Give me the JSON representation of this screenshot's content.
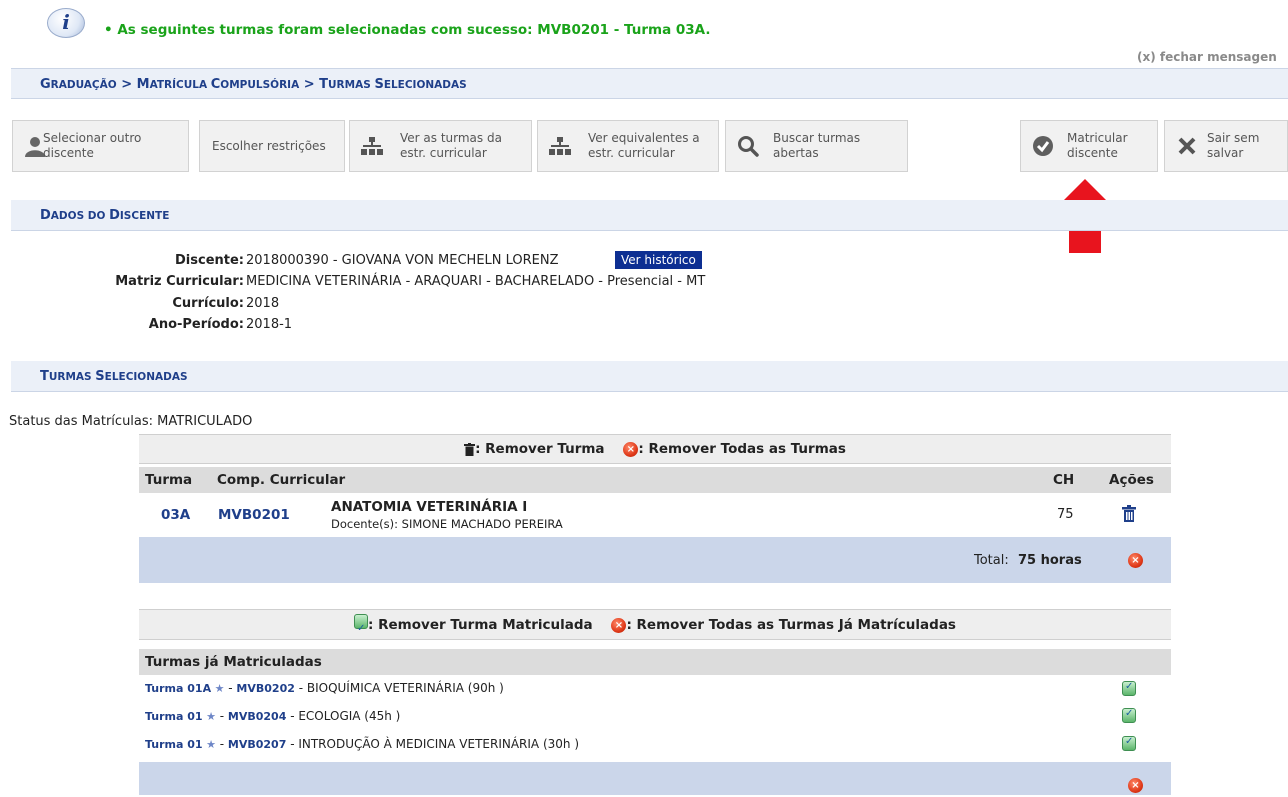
{
  "message": {
    "text": "• As seguintes turmas foram selecionadas com sucesso: MVB0201 - Turma 03A.",
    "close": "(x) fechar mensagen"
  },
  "breadcrumb": {
    "part1_first": "G",
    "part1_rest": "RADUAÇÃO",
    "sep1": " > ",
    "part2_first": "M",
    "part2_rest": "ATRÍCULA ",
    "part2b_first": "C",
    "part2b_rest": "OMPULSÓRIA",
    "sep2": " > ",
    "part3_first": "T",
    "part3_rest": "URMAS ",
    "part3b_first": "S",
    "part3b_rest": "ELECIONADAS"
  },
  "toolbar": {
    "select_student": [
      "Selecionar outro",
      "discente"
    ],
    "choose_restrictions": "Escolher restrições",
    "view_curricular": [
      "Ver as turmas da",
      "estr. curricular"
    ],
    "view_equivalents": [
      "Ver equivalentes a",
      "estr. curricular"
    ],
    "search_open": [
      "Buscar turmas",
      "abertas"
    ],
    "enroll_student": [
      "Matricular",
      "discente"
    ],
    "exit_without_save": [
      "Sair sem",
      "salvar"
    ]
  },
  "student_section": {
    "title_first": "D",
    "title_rest": "ADOS DO ",
    "title_first2": "D",
    "title_rest2": "ISCENTE",
    "labels": {
      "discente": "Discente:",
      "matriz": "Matriz Curricular:",
      "curriculo": "Currículo:",
      "ano": "Ano-Período:"
    },
    "values": {
      "discente": "2018000390 - GIOVANA VON MECHELN LORENZ",
      "matriz": "MEDICINA VETERINÁRIA - ARAQUARI - BACHARELADO - Presencial - MT",
      "curriculo": "2018",
      "ano": "2018-1"
    },
    "history_button": "Ver histórico"
  },
  "selected_section": {
    "title_first": "T",
    "title_rest": "URMAS ",
    "title_first2": "S",
    "title_rest2": "ELECIONADAS",
    "status": "Status das Matrículas: MATRICULADO",
    "legend_remove": ": Remover Turma",
    "legend_remove_all": ": Remover Todas as Turmas",
    "headers": {
      "turma": "Turma",
      "comp": "Comp. Curricular",
      "ch": "CH",
      "acoes": "Ações"
    },
    "rows": [
      {
        "turma": "03A",
        "code": "MVB0201",
        "name": "ANATOMIA VETERINÁRIA I",
        "teachers": "Docente(s): SIMONE MACHADO PEREIRA",
        "ch": "75"
      }
    ],
    "total_label": "Total: ",
    "total_value": "75 horas"
  },
  "enrolled_section": {
    "legend_remove": ": Remover Turma Matriculada",
    "legend_remove_all": ": Remover Todas as Turmas Já Matrículadas",
    "header": "Turmas já Matriculadas",
    "rows": [
      {
        "turma": "Turma 01A",
        "code": "MVB0202",
        "desc": " - BIOQUÍMICA VETERINÁRIA (90h )"
      },
      {
        "turma": "Turma 01",
        "code": "MVB0204",
        "desc": " - ECOLOGIA (45h )"
      },
      {
        "turma": "Turma 01",
        "code": "MVB0207",
        "desc": " - INTRODUÇÃO À MEDICINA VETERINÁRIA (30h )"
      }
    ]
  },
  "colors": {
    "link": "#1f3f8a",
    "success": "#1aa31a",
    "accent_arrow": "#e8141e",
    "history_btn": "#0d2f92"
  }
}
